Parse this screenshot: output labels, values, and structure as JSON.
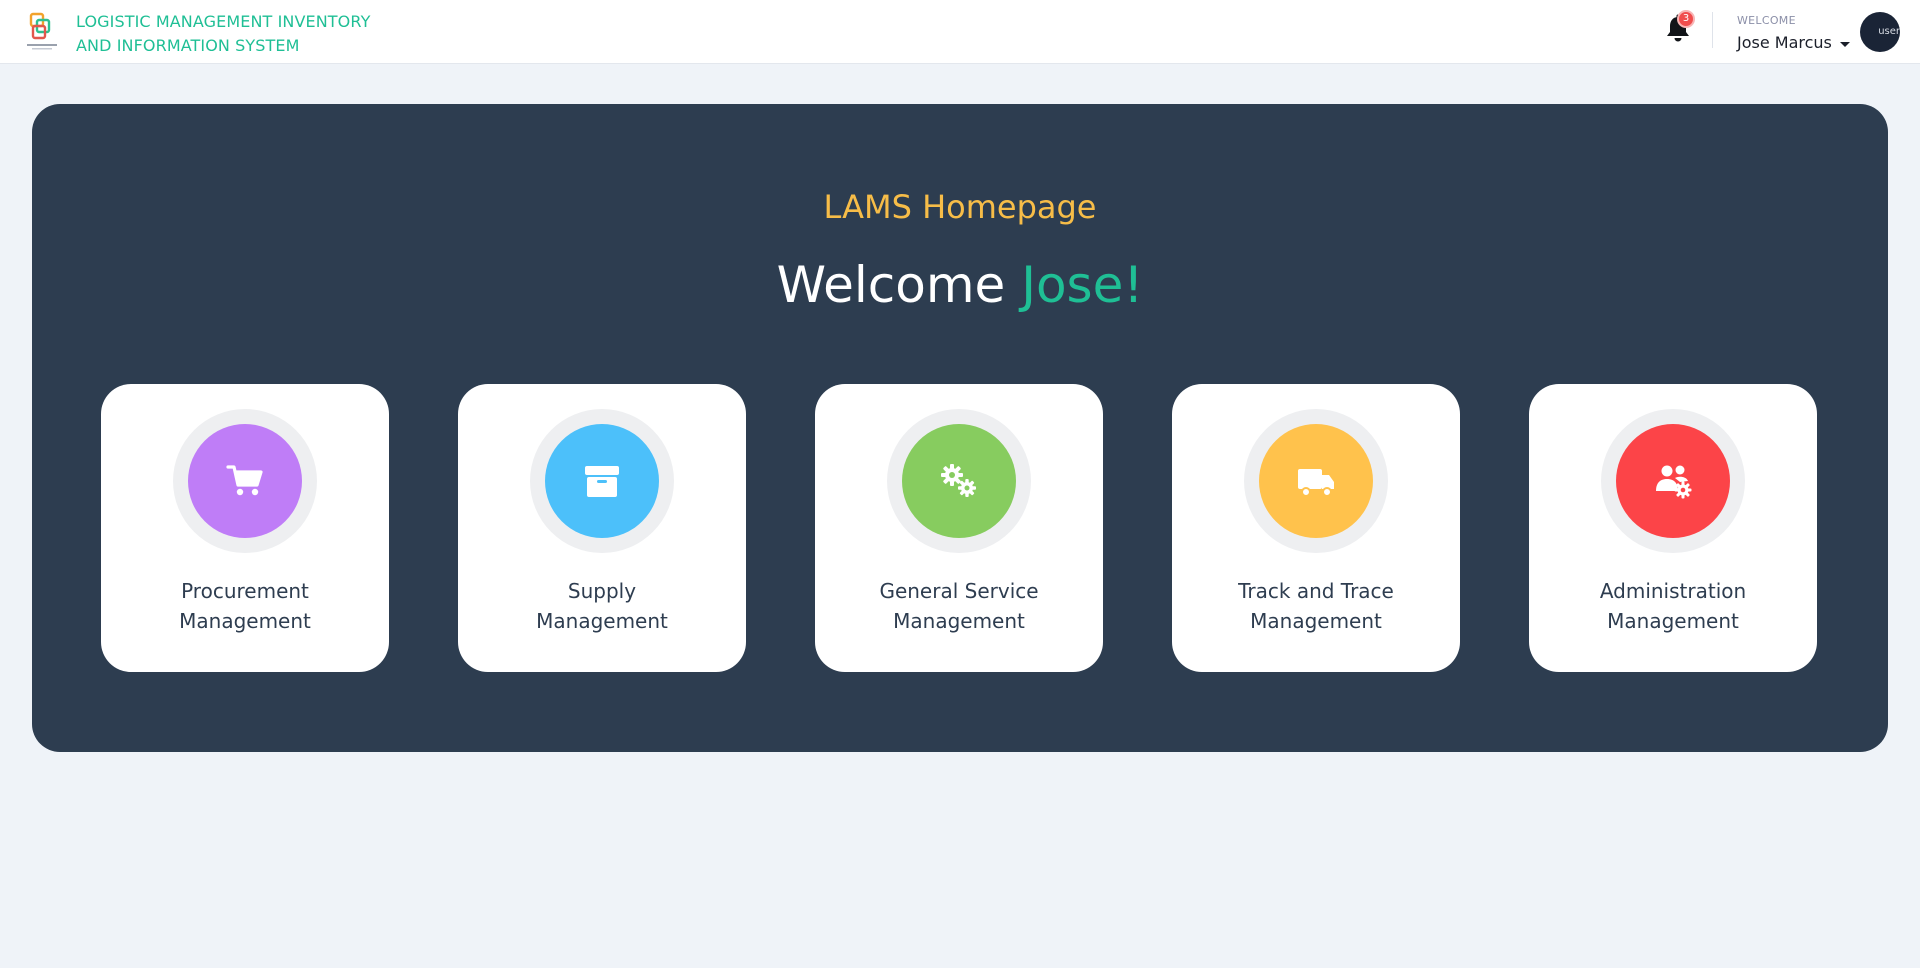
{
  "header": {
    "system_title_line1": "LOGISTIC MANAGEMENT INVENTORY",
    "system_title_line2": "AND INFORMATION SYSTEM",
    "notification_count": "3",
    "welcome_label": "WELCOME",
    "user_name": "Jose Marcus",
    "avatar_alt": "user"
  },
  "hero": {
    "subtitle": "LAMS Homepage",
    "welcome_prefix": "Welcome",
    "welcome_name": "Jose!"
  },
  "modules": [
    {
      "line1": "Procurement",
      "line2": "Management",
      "color": "#bf7df7",
      "icon": "cart-icon"
    },
    {
      "line1": "Supply",
      "line2": "Management",
      "color": "#4cc0fa",
      "icon": "box-icon"
    },
    {
      "line1": "General Service",
      "line2": "Management",
      "color": "#87cc5f",
      "icon": "gears-icon"
    },
    {
      "line1": "Track and Trace",
      "line2": "Management",
      "color": "#ffc24c",
      "icon": "truck-icon"
    },
    {
      "line1": "Administration",
      "line2": "Management",
      "color": "#fc4448",
      "icon": "users-cog-icon"
    }
  ],
  "colors": {
    "accent_green": "#1fbf95",
    "accent_yellow": "#f7bd48",
    "panel_bg": "#2d3d50",
    "page_bg": "#eff3f8"
  }
}
